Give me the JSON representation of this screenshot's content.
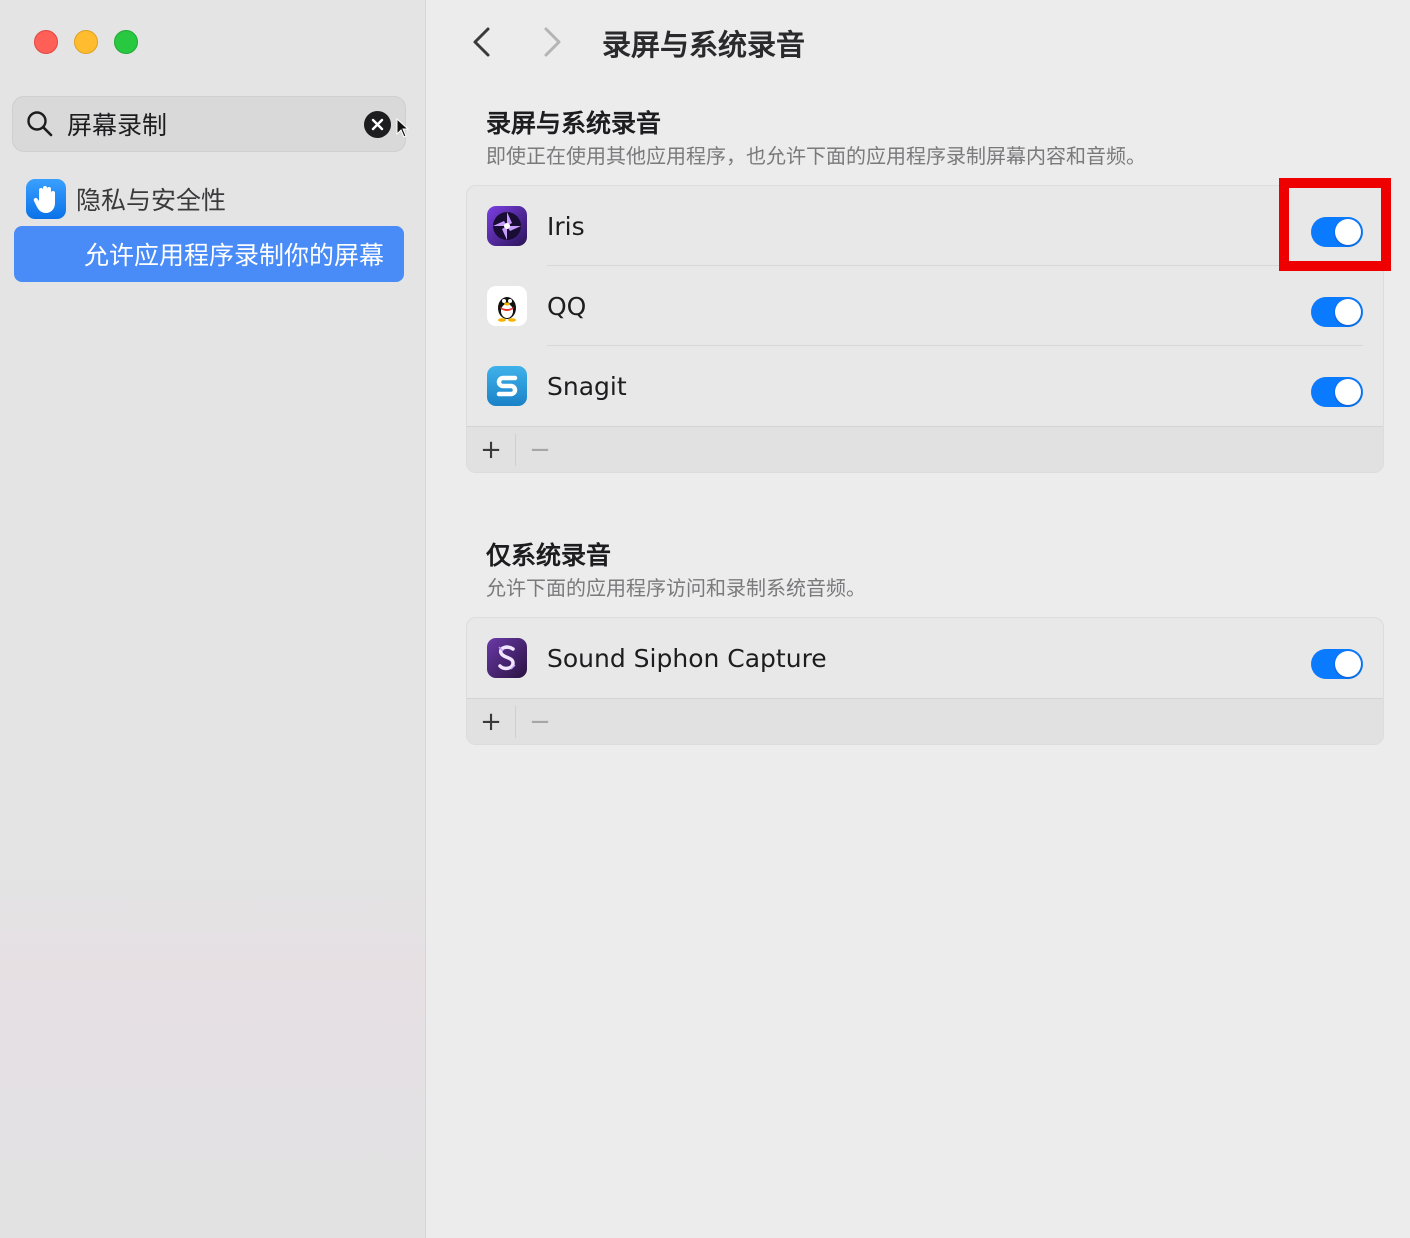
{
  "sidebar": {
    "search": {
      "value": "屏幕录制"
    },
    "category": {
      "label": "隐私与安全性"
    },
    "selected_item": {
      "label": "允许应用程序录制你的屏幕"
    }
  },
  "header": {
    "title": "录屏与系统录音"
  },
  "section_screen": {
    "title": "录屏与系统录音",
    "description": "即使正在使用其他应用程序，也允许下面的应用程序录制屏幕内容和音频。",
    "apps": [
      {
        "name": "Iris",
        "enabled": true
      },
      {
        "name": "QQ",
        "enabled": true
      },
      {
        "name": "Snagit",
        "enabled": true
      }
    ]
  },
  "section_audio": {
    "title": "仅系统录音",
    "description": "允许下面的应用程序访问和录制系统音频。",
    "apps": [
      {
        "name": "Sound Siphon Capture",
        "enabled": true
      }
    ]
  },
  "footer_buttons": {
    "add": "+",
    "remove": "−"
  },
  "colors": {
    "accent": "#0a7aff",
    "selection": "#4a8cf7",
    "highlight": "#ee0000"
  }
}
